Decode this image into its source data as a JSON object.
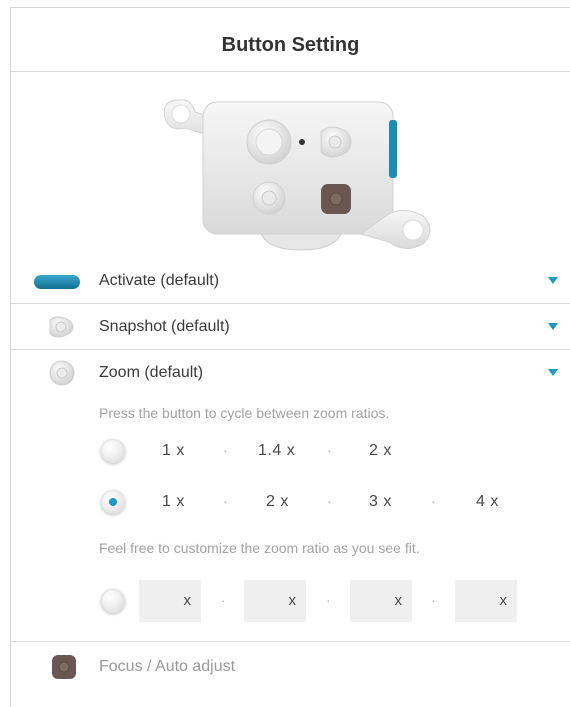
{
  "header": {
    "title": "Button Setting"
  },
  "buttons": [
    {
      "label": "Activate (default)",
      "icon": "activate-button-icon"
    },
    {
      "label": "Snapshot (default)",
      "icon": "snapshot-button-icon"
    },
    {
      "label": "Zoom (default)",
      "icon": "zoom-button-icon"
    },
    {
      "label": "Focus / Auto adjust",
      "icon": "focus-button-icon"
    }
  ],
  "zoom": {
    "hint_cycle": "Press the button to cycle between zoom ratios.",
    "option1": {
      "selected": false,
      "ratios": [
        "1 x",
        "1.4 x",
        "2 x"
      ]
    },
    "option2": {
      "selected": true,
      "ratios": [
        "1 x",
        "2 x",
        "3 x",
        "4 x"
      ]
    },
    "hint_custom": "Feel free to customize the zoom ratio as you see fit.",
    "custom": {
      "selected": false,
      "suffix": "x",
      "separator": "·",
      "values": [
        "",
        "",
        "",
        ""
      ]
    }
  },
  "colors": {
    "accent": "#1d98c2",
    "activate": "#1b7fa6",
    "focus": "#6a5751"
  }
}
